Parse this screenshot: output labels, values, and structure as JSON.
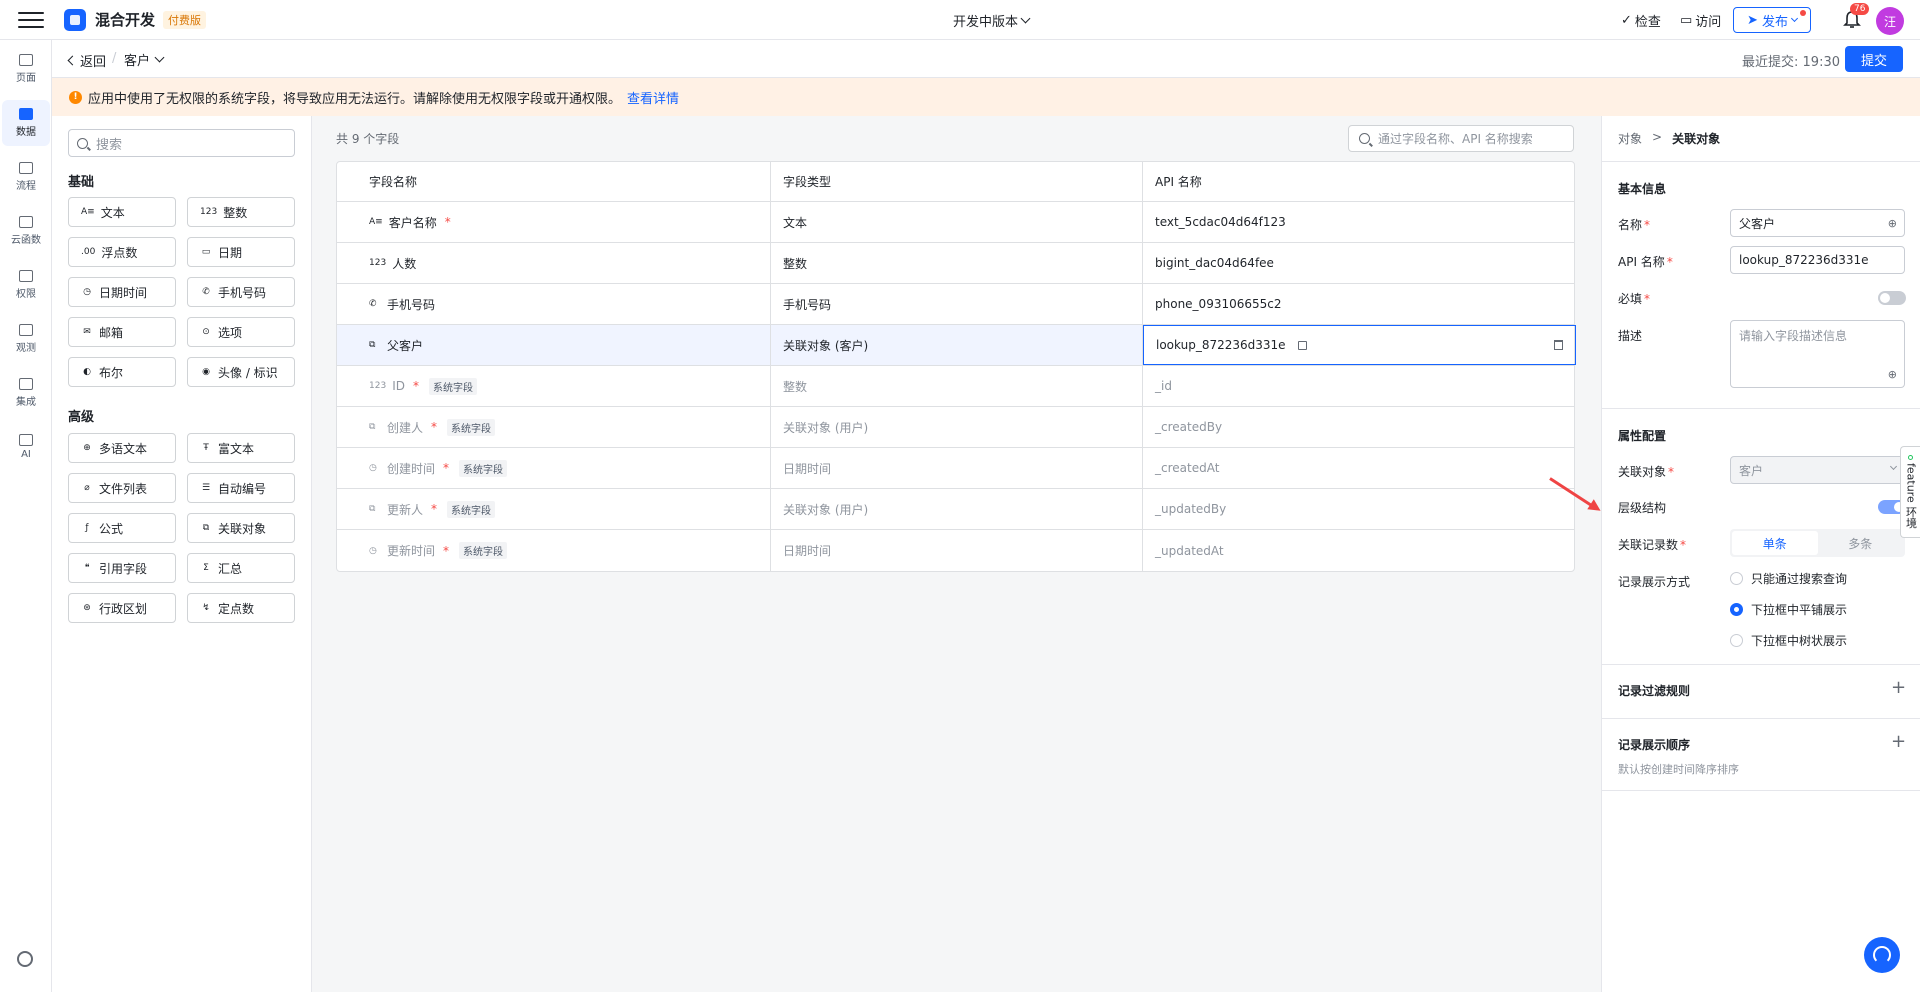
{
  "topbar": {
    "app_title": "混合开发",
    "plan_badge": "付费版",
    "version_label": "开发中版本",
    "inspect_label": "检查",
    "visit_label": "访问",
    "publish_label": "发布",
    "notif_count": "76",
    "avatar_text": "汪"
  },
  "leftnav": {
    "items": [
      {
        "label": "页面"
      },
      {
        "label": "数据"
      },
      {
        "label": "流程"
      },
      {
        "label": "云函数"
      },
      {
        "label": "权限"
      },
      {
        "label": "观测"
      },
      {
        "label": "集成"
      },
      {
        "label": "AI"
      }
    ]
  },
  "subbar": {
    "back_label": "返回",
    "crumb_sep": "/",
    "current_object": "客户",
    "last_commit_label": "最近提交:",
    "last_commit_time": "19:30",
    "submit_label": "提交"
  },
  "warning": {
    "text": "应用中使用了无权限的系统字段，将导致应用无法运行。请解除使用无权限字段或开通权限。",
    "link": "查看详情"
  },
  "field_panel": {
    "search_placeholder": "搜索",
    "basic_title": "基础",
    "basic": [
      {
        "icon": "A≡",
        "label": "文本"
      },
      {
        "icon": "123",
        "label": "整数"
      },
      {
        "icon": ".00",
        "label": "浮点数"
      },
      {
        "icon": "▭",
        "label": "日期"
      },
      {
        "icon": "◷",
        "label": "日期时间"
      },
      {
        "icon": "✆",
        "label": "手机号码"
      },
      {
        "icon": "✉",
        "label": "邮箱"
      },
      {
        "icon": "⊙",
        "label": "选项"
      },
      {
        "icon": "◐",
        "label": "布尔"
      },
      {
        "icon": "◉",
        "label": "头像 / 标识"
      }
    ],
    "advanced_title": "高级",
    "advanced": [
      {
        "icon": "⊕",
        "label": "多语文本"
      },
      {
        "icon": "Ŧ",
        "label": "富文本"
      },
      {
        "icon": "⌀",
        "label": "文件列表"
      },
      {
        "icon": "☰",
        "label": "自动编号"
      },
      {
        "icon": "ƒ",
        "label": "公式"
      },
      {
        "icon": "⧉",
        "label": "关联对象"
      },
      {
        "icon": "❝",
        "label": "引用字段"
      },
      {
        "icon": "Σ",
        "label": "汇总"
      },
      {
        "icon": "⊛",
        "label": "行政区划"
      },
      {
        "icon": "↯",
        "label": "定点数"
      }
    ]
  },
  "table": {
    "count_text": "共 9 个字段",
    "search_placeholder": "通过字段名称、API 名称搜索",
    "headers": [
      "字段名称",
      "字段类型",
      "API 名称"
    ],
    "rows": [
      {
        "icon": "A≡",
        "name": "客户名称",
        "required": "*",
        "sys_tag": "",
        "type": "文本",
        "api": "text_5cdac04d64f123"
      },
      {
        "icon": "123",
        "name": "人数",
        "required": "",
        "sys_tag": "",
        "type": "整数",
        "api": "bigint_dac04d64fee"
      },
      {
        "icon": "✆",
        "name": "手机号码",
        "required": "",
        "sys_tag": "",
        "type": "手机号码",
        "api": "phone_093106655c2"
      },
      {
        "icon": "⧉",
        "name": "父客户",
        "required": "",
        "sys_tag": "",
        "type": "关联对象 (客户)",
        "api": "lookup_872236d331e"
      },
      {
        "icon": "123",
        "name": "ID",
        "required": "*",
        "sys_tag": "系统字段",
        "type": "整数",
        "api": "_id"
      },
      {
        "icon": "⧉",
        "name": "创建人",
        "required": "*",
        "sys_tag": "系统字段",
        "type": "关联对象 (用户)",
        "api": "_createdBy"
      },
      {
        "icon": "◷",
        "name": "创建时间",
        "required": "*",
        "sys_tag": "系统字段",
        "type": "日期时间",
        "api": "_createdAt"
      },
      {
        "icon": "⧉",
        "name": "更新人",
        "required": "*",
        "sys_tag": "系统字段",
        "type": "关联对象 (用户)",
        "api": "_updatedBy"
      },
      {
        "icon": "◷",
        "name": "更新时间",
        "required": "*",
        "sys_tag": "系统字段",
        "type": "日期时间",
        "api": "_updatedAt"
      }
    ]
  },
  "right_panel": {
    "crumb_parent": "对象",
    "crumb_sep": ">",
    "crumb_current": "关联对象",
    "basic_title": "基本信息",
    "name_label": "名称",
    "name_value": "父客户",
    "api_label": "API 名称",
    "api_value": "lookup_872236d331e",
    "required_label": "必填",
    "required_on": false,
    "desc_label": "描述",
    "desc_placeholder": "请输入字段描述信息",
    "props_title": "属性配置",
    "link_object_label": "关联对象",
    "link_object_value": "客户",
    "hierarchy_label": "层级结构",
    "hierarchy_on": true,
    "record_count_label": "关联记录数",
    "record_single": "单条",
    "record_multi": "多条",
    "display_mode_label": "记录展示方式",
    "display_options": [
      "只能通过搜索查询",
      "下拉框中平铺展示",
      "下拉框中树状展示"
    ],
    "display_selected": 1,
    "filter_rule_label": "记录过滤规则",
    "order_label": "记录展示顺序",
    "order_note": "默认按创建时间降序排序",
    "star": "*",
    "plus": "+"
  },
  "side_tab": {
    "label": "feature 环境"
  },
  "colors": {
    "accent": "#1664ff",
    "warning_bg": "#fff1e5",
    "required": "#f54a45"
  }
}
